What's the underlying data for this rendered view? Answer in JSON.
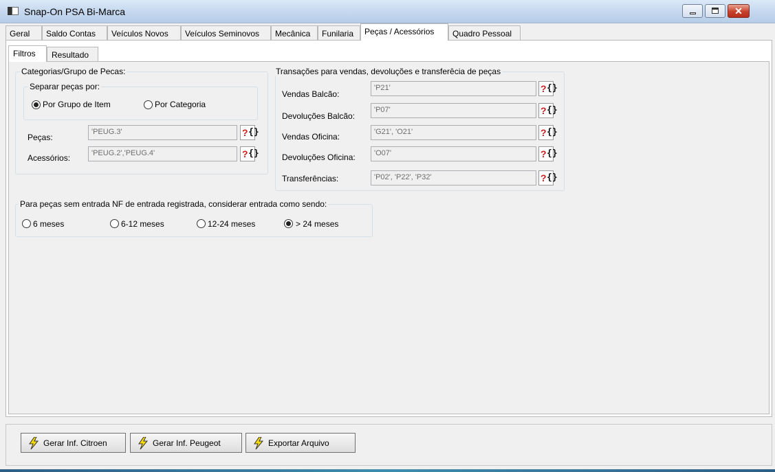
{
  "window": {
    "title": "Snap-On PSA Bi-Marca",
    "close_glyph": "✕"
  },
  "main_tabs": [
    "Geral",
    "Saldo Contas",
    "Veículos Novos",
    "Veículos Seminovos",
    "Mecânica",
    "Funilaria",
    "Peças / Acessórios",
    "Quadro Pessoal"
  ],
  "sub_tabs": [
    "Filtros",
    "Resultado"
  ],
  "categorias": {
    "legend": "Categorias/Grupo de Pecas:",
    "separar_legend": "Separar peças por:",
    "option_grupo": "Por Grupo de Item",
    "option_categoria": "Por Categoria",
    "pecas_label": "Peças:",
    "pecas_value": "'PEUG.3'",
    "acessorios_label": "Acessórios:",
    "acessorios_value": "'PEUG.2','PEUG.4'"
  },
  "transacoes": {
    "legend": "Transações para vendas, devoluções e transferêcia de peças",
    "rows": [
      {
        "label": "Vendas Balcão:",
        "value": "'P21'"
      },
      {
        "label": "Devoluções Balcão:",
        "value": "'P07'"
      },
      {
        "label": "Vendas Oficina:",
        "value": "'G21', 'O21'"
      },
      {
        "label": "Devoluções Oficina:",
        "value": "'O07'"
      },
      {
        "label": "Transferências:",
        "value": "'P02', 'P22', 'P32'"
      }
    ]
  },
  "entrada": {
    "legend": "Para peças sem entrada NF de entrada registrada, considerar entrada como sendo:",
    "options": [
      "6 meses",
      "6-12 meses",
      "12-24 meses",
      "> 24 meses"
    ],
    "selected": "> 24 meses"
  },
  "query_button": {
    "q": "?",
    "bracket": "{}"
  },
  "actions": {
    "gerar_citroen": "Gerar Inf. Citroen",
    "gerar_peugeot": "Gerar Inf. Peugeot",
    "exportar": "Exportar Arquivo"
  },
  "colors": {
    "accent_red": "#d21a1a",
    "bolt_yellow": "#f5d90a"
  },
  "icons": [
    "app-icon",
    "minimize-icon",
    "maximize-icon",
    "close-icon",
    "query-lookup-icon",
    "lightning-icon"
  ]
}
